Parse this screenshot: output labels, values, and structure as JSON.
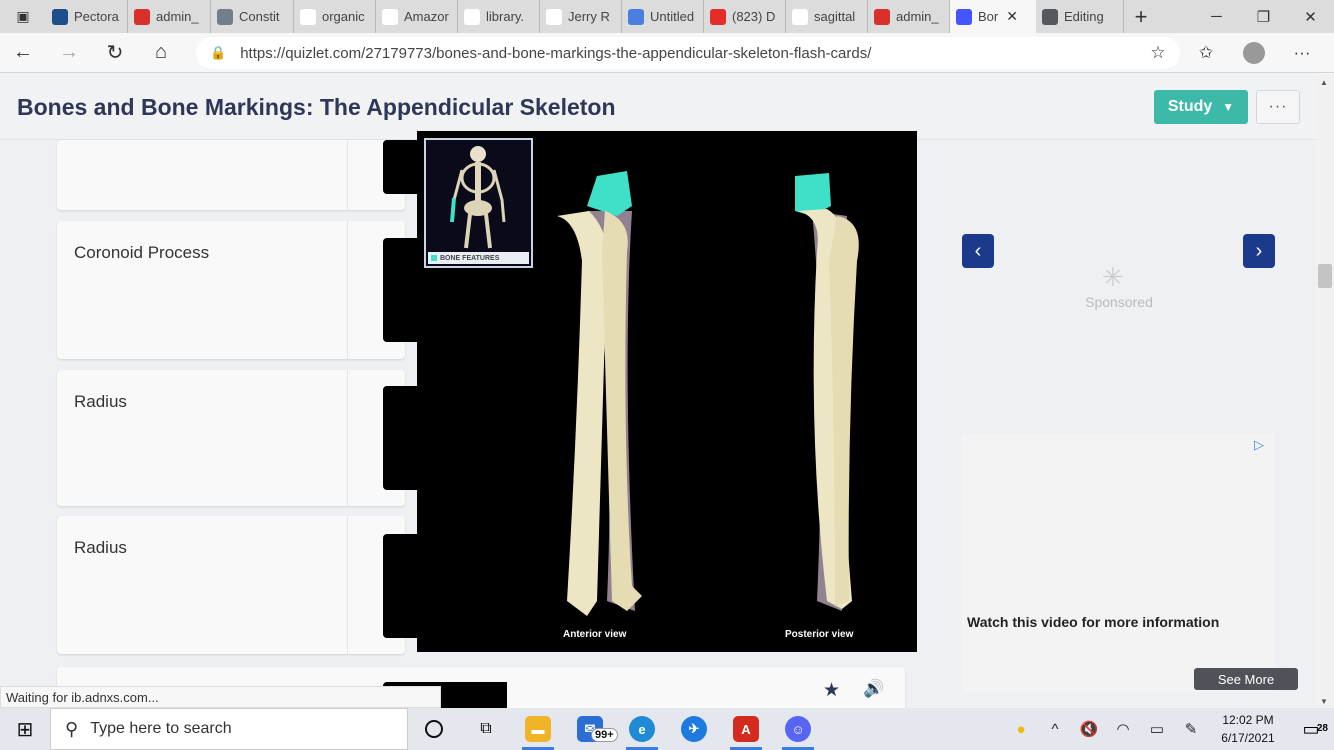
{
  "browser": {
    "tabs": [
      {
        "label": "Pectora",
        "icon": "pectoral-icon",
        "color": "#1e4f8c"
      },
      {
        "label": "admin_",
        "icon": "pdf-icon",
        "color": "#d9302c"
      },
      {
        "label": "Constit",
        "icon": "constitution-icon",
        "color": "#707f8a"
      },
      {
        "label": "organic",
        "icon": "google-icon",
        "color": "#ffffff"
      },
      {
        "label": "Amazor",
        "icon": "amazon-icon",
        "color": "#ffffff"
      },
      {
        "label": "library.",
        "icon": "page-icon",
        "color": "#ffffff"
      },
      {
        "label": "Jerry R",
        "icon": "pdf-outline-icon",
        "color": "#ffffff"
      },
      {
        "label": "Untitled",
        "icon": "docs-icon",
        "color": "#4a7fe0"
      },
      {
        "label": "(823) D",
        "icon": "youtube-icon",
        "color": "#e52d27"
      },
      {
        "label": "sagittal",
        "icon": "google-icon",
        "color": "#ffffff"
      },
      {
        "label": "admin_",
        "icon": "pdf-icon",
        "color": "#d9302c"
      },
      {
        "label": "Bor",
        "icon": "quizlet-icon",
        "color": "#4255ff"
      },
      {
        "label": "Editing",
        "icon": "editing-icon",
        "color": "#55595e"
      }
    ],
    "url": "https://quizlet.com/27179773/bones-and-bone-markings-the-appendicular-skeleton-flash-cards/"
  },
  "page": {
    "title": "Bones and Bone Markings: The Appendicular Skeleton",
    "study_label": "Study",
    "more_label": "···",
    "cards": [
      {
        "term": "Coronoid Process"
      },
      {
        "term": "Radius"
      },
      {
        "term": "Radius"
      }
    ],
    "lightbox": {
      "thumb_label": "BONE FEATURES",
      "anterior_caption": "Anterior view",
      "posterior_caption": "Posterior view"
    },
    "ad": {
      "sponsored": "Sponsored",
      "video_text": "Watch this video for more information",
      "see_more": "See More"
    },
    "status": "Waiting for ib.adnxs.com..."
  },
  "taskbar": {
    "search_placeholder": "Type here to search",
    "mail_badge": "99+",
    "time": "12:02 PM",
    "date": "6/17/2021",
    "notifications": "28"
  },
  "colors": {
    "accent": "#3cb9a8",
    "title": "#2e3856",
    "ad_nav": "#1b3a8c",
    "bone_highlight": "#3fe0c8"
  }
}
